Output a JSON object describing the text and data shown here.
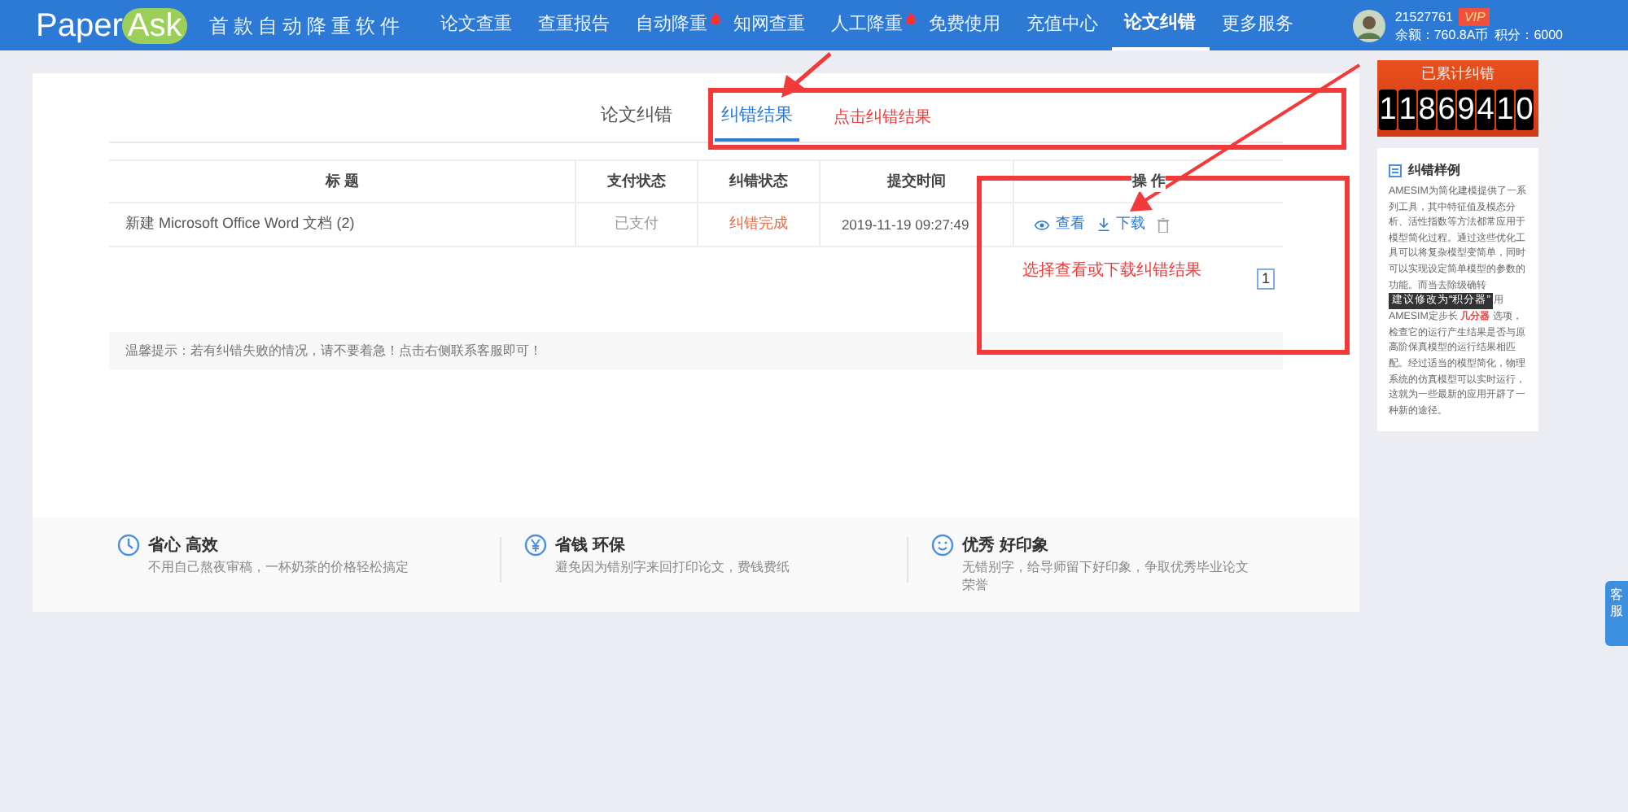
{
  "header": {
    "logo": [
      "Paper",
      "Ask"
    ],
    "slogan": "首款自动降重软件",
    "nav": [
      {
        "label": "论文查重",
        "hot": false,
        "selected": false
      },
      {
        "label": "查重报告",
        "hot": false,
        "selected": false
      },
      {
        "label": "自动降重",
        "hot": true,
        "selected": false
      },
      {
        "label": "知网查重",
        "hot": false,
        "selected": false
      },
      {
        "label": "人工降重",
        "hot": true,
        "selected": false
      },
      {
        "label": "免费使用",
        "hot": false,
        "selected": false
      },
      {
        "label": "充值中心",
        "hot": false,
        "selected": false
      },
      {
        "label": "论文纠错",
        "hot": false,
        "selected": true
      },
      {
        "label": "更多服务",
        "hot": false,
        "selected": false
      }
    ],
    "user": {
      "id": "21527761",
      "badge": "VIP",
      "balance": "余额：760.8A币",
      "points": "积分：6000"
    }
  },
  "tabs": [
    {
      "label": "论文纠错",
      "selected": false
    },
    {
      "label": "纠错结果",
      "selected": true
    }
  ],
  "table": {
    "columns": [
      "标 题",
      "支付状态",
      "纠错状态",
      "提交时间",
      "操 作"
    ],
    "rows": [
      {
        "title": "新建 Microsoft Office Word 文档 (2)",
        "payment": "已支付",
        "status": "纠错完成",
        "time": "2019-11-19 09:27:49",
        "actions": [
          "查看",
          "下载"
        ]
      }
    ]
  },
  "pagination": [
    {
      "label": "1",
      "selected": true
    }
  ],
  "tip": "温馨提示：若有纠错失败的情况，请不要着急！点击右侧联系客服即可！",
  "features": [
    {
      "title": "省心 高效",
      "text": "不用自己熬夜审稿，一杯奶茶的价格轻松搞定"
    },
    {
      "title": "省钱 环保",
      "text": "避免因为错别字来回打印论文，费钱费纸"
    },
    {
      "title": "优秀 好印象",
      "text": "无错别字，给导师留下好印象，争取优秀毕业论文荣誉"
    }
  ],
  "counter": {
    "title": "已累计纠错",
    "digits": [
      "1",
      "1",
      "8",
      "6",
      "9",
      "4",
      "1",
      "0"
    ]
  },
  "sample": {
    "title": "纠错样例",
    "text_before": "AMESIM为简化建模提供了一系列工具，其中特征值及模态分析、活性指数等方法都常应用于模型简化过程。通过这些优化工具可以将复杂模型变简单，同时可以实现设定简单模型的参数的功能。而当去除级确转",
    "tooltip": "建议修改为“积分器”",
    "text_after": "用AMESIM定步长 **几分器** 选项，检查它的运行产生结果是否与原高阶保真模型的运行结果相匹配。经过适当的模型简化，物理系统的仿真模型可以实时运行，这就为一些最新的应用开辟了一种新的途径。"
  },
  "side_tab": "客服",
  "annotations": [
    "点击纠错结果",
    "选择查看或下载纠错结果"
  ]
}
